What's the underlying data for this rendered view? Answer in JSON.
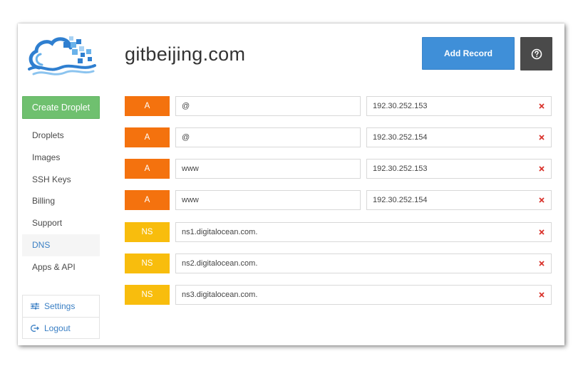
{
  "page": {
    "title": "gitbeijing.com"
  },
  "header": {
    "add_record_label": "Add Record"
  },
  "sidebar": {
    "create_label": "Create Droplet",
    "items": [
      {
        "label": "Droplets",
        "active": false
      },
      {
        "label": "Images",
        "active": false
      },
      {
        "label": "SSH Keys",
        "active": false
      },
      {
        "label": "Billing",
        "active": false
      },
      {
        "label": "Support",
        "active": false
      },
      {
        "label": "DNS",
        "active": true
      },
      {
        "label": "Apps & API",
        "active": false
      }
    ],
    "settings_label": "Settings",
    "logout_label": "Logout"
  },
  "records": [
    {
      "type": "A",
      "name": "@",
      "value": "192.30.252.153"
    },
    {
      "type": "A",
      "name": "@",
      "value": "192.30.252.154"
    },
    {
      "type": "A",
      "name": "www",
      "value": "192.30.252.153"
    },
    {
      "type": "A",
      "name": "www",
      "value": "192.30.252.154"
    },
    {
      "type": "NS",
      "name": "ns1.digitalocean.com."
    },
    {
      "type": "NS",
      "name": "ns2.digitalocean.com."
    },
    {
      "type": "NS",
      "name": "ns3.digitalocean.com."
    }
  ],
  "colors": {
    "accent_blue": "#3f8fd8",
    "create_green": "#6fc06f",
    "type_a": "#f4720e",
    "type_ns": "#f8bd0d",
    "delete_red": "#d9322b",
    "help_dark": "#4a4a4a"
  },
  "icons": {
    "help": "question-circle-icon",
    "settings": "sliders-icon",
    "logout": "logout-icon",
    "delete": "close-icon"
  }
}
